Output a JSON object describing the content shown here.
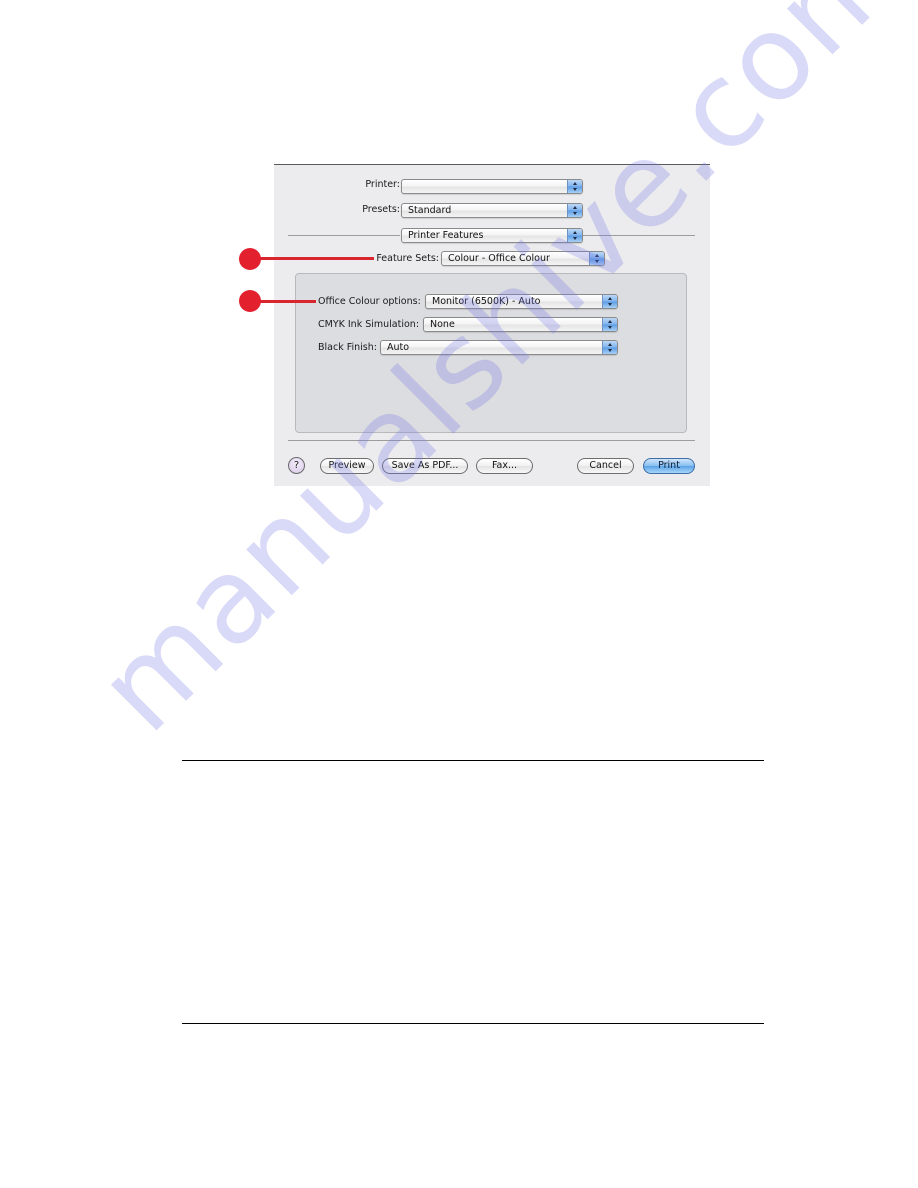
{
  "dialog": {
    "printer": {
      "label": "Printer:",
      "value": ""
    },
    "presets": {
      "label": "Presets:",
      "value": "Standard"
    },
    "section_popup": {
      "value": "Printer Features"
    },
    "feature_sets": {
      "label": "Feature Sets:",
      "value": "Colour - Office Colour"
    },
    "options": [
      {
        "label": "Office Colour options:",
        "value": "Monitor (6500K) - Auto"
      },
      {
        "label": "CMYK Ink Simulation:",
        "value": "None"
      },
      {
        "label": "Black Finish:",
        "value": "Auto"
      }
    ],
    "buttons": {
      "help": "?",
      "preview": "Preview",
      "save_as_pdf": "Save As PDF...",
      "fax": "Fax...",
      "cancel": "Cancel",
      "print": "Print"
    }
  },
  "callouts": [
    {
      "target": "Feature Sets",
      "color": "#e3202e"
    },
    {
      "target": "Office Colour options",
      "color": "#e3202e"
    }
  ],
  "watermark": {
    "text": "manualshive.com"
  }
}
